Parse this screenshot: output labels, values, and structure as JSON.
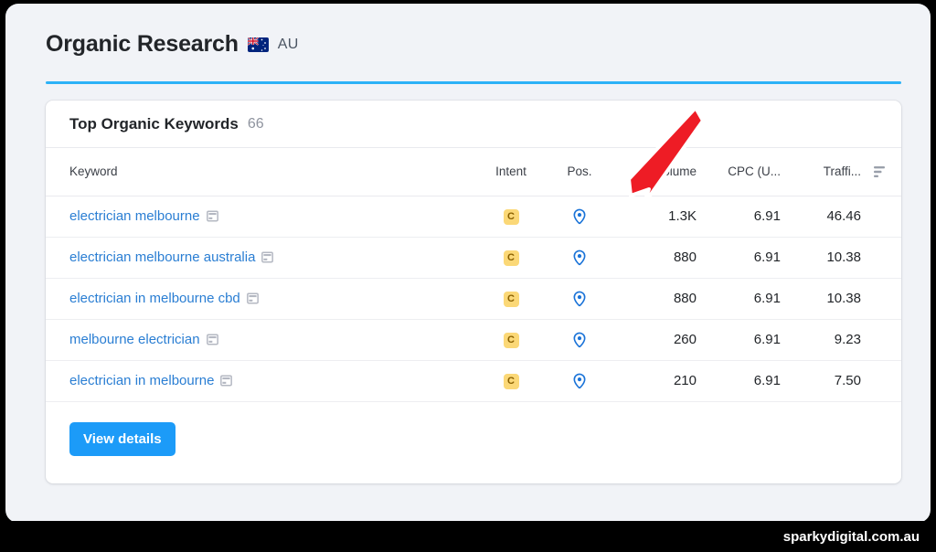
{
  "header": {
    "title": "Organic Research",
    "country_code": "AU",
    "flag_icon": "au-flag-icon",
    "accent_color": "#2cb2f7"
  },
  "card": {
    "title": "Top Organic Keywords",
    "count": "66",
    "columns": [
      {
        "label": "Keyword",
        "key": "keyword"
      },
      {
        "label": "Intent",
        "key": "intent"
      },
      {
        "label": "Pos.",
        "key": "pos"
      },
      {
        "label": "Volume",
        "key": "volume"
      },
      {
        "label": "CPC (U...",
        "key": "cpc"
      },
      {
        "label": "Traffi...",
        "key": "traffic"
      }
    ],
    "sort_icon": "sort-descending-icon",
    "rows": [
      {
        "keyword": "electrician melbourne",
        "serp_icon": "serp-features-icon",
        "intent": "C",
        "pos_icon": "map-pin-icon",
        "volume": "1.3K",
        "cpc": "6.91",
        "traffic": "46.46"
      },
      {
        "keyword": "electrician melbourne australia",
        "serp_icon": "serp-features-icon",
        "intent": "C",
        "pos_icon": "map-pin-icon",
        "volume": "880",
        "cpc": "6.91",
        "traffic": "10.38"
      },
      {
        "keyword": "electrician in melbourne cbd",
        "serp_icon": "serp-features-icon",
        "intent": "C",
        "pos_icon": "map-pin-icon",
        "volume": "880",
        "cpc": "6.91",
        "traffic": "10.38"
      },
      {
        "keyword": "melbourne electrician",
        "serp_icon": "serp-features-icon",
        "intent": "C",
        "pos_icon": "map-pin-icon",
        "volume": "260",
        "cpc": "6.91",
        "traffic": "9.23"
      },
      {
        "keyword": "electrician in melbourne",
        "serp_icon": "serp-features-icon",
        "intent": "C",
        "pos_icon": "map-pin-icon",
        "volume": "210",
        "cpc": "6.91",
        "traffic": "7.50"
      }
    ],
    "view_details_label": "View details",
    "button_color": "#1c9bf8"
  },
  "annotation": {
    "arrow_icon": "red-arrow-icon",
    "arrow_color": "#ee1c25",
    "points_at": "Pos."
  },
  "footer": {
    "watermark": "sparkydigital.com.au"
  }
}
